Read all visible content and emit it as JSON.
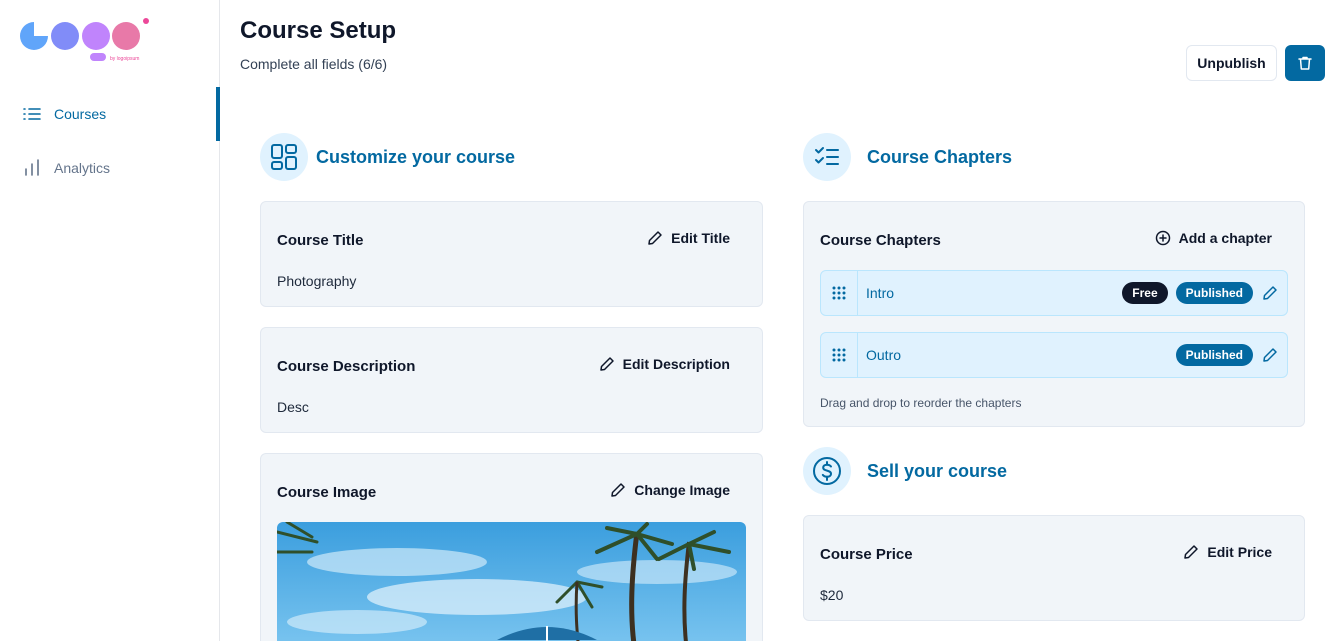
{
  "sidebar": {
    "logo_text": "by logoipsum",
    "items": [
      {
        "label": "Courses",
        "icon": "list-icon",
        "active": true
      },
      {
        "label": "Analytics",
        "icon": "bar-chart-icon",
        "active": false
      }
    ]
  },
  "header": {
    "title": "Course Setup",
    "subtitle": "Complete all fields (6/6)",
    "unpublish_label": "Unpublish",
    "delete_icon": "trash-icon"
  },
  "customize": {
    "title": "Customize your course",
    "title_card": {
      "label": "Course Title",
      "action": "Edit Title",
      "value": "Photography"
    },
    "description_card": {
      "label": "Course Description",
      "action": "Edit Description",
      "value": "Desc"
    },
    "image_card": {
      "label": "Course Image",
      "action": "Change Image"
    }
  },
  "chapters": {
    "title": "Course Chapters",
    "card_label": "Course Chapters",
    "add_label": "Add a chapter",
    "items": [
      {
        "title": "Intro",
        "free": "Free",
        "status": "Published"
      },
      {
        "title": "Outro",
        "status": "Published"
      }
    ],
    "hint": "Drag and drop to reorder the chapters"
  },
  "sell": {
    "title": "Sell your course",
    "price_card": {
      "label": "Course Price",
      "action": "Edit Price",
      "value": "$20"
    }
  },
  "colors": {
    "accent": "#0369a1",
    "accent_light": "#e0f2fe",
    "card_bg": "#f1f5f9",
    "badge_dark": "#0f172a"
  }
}
